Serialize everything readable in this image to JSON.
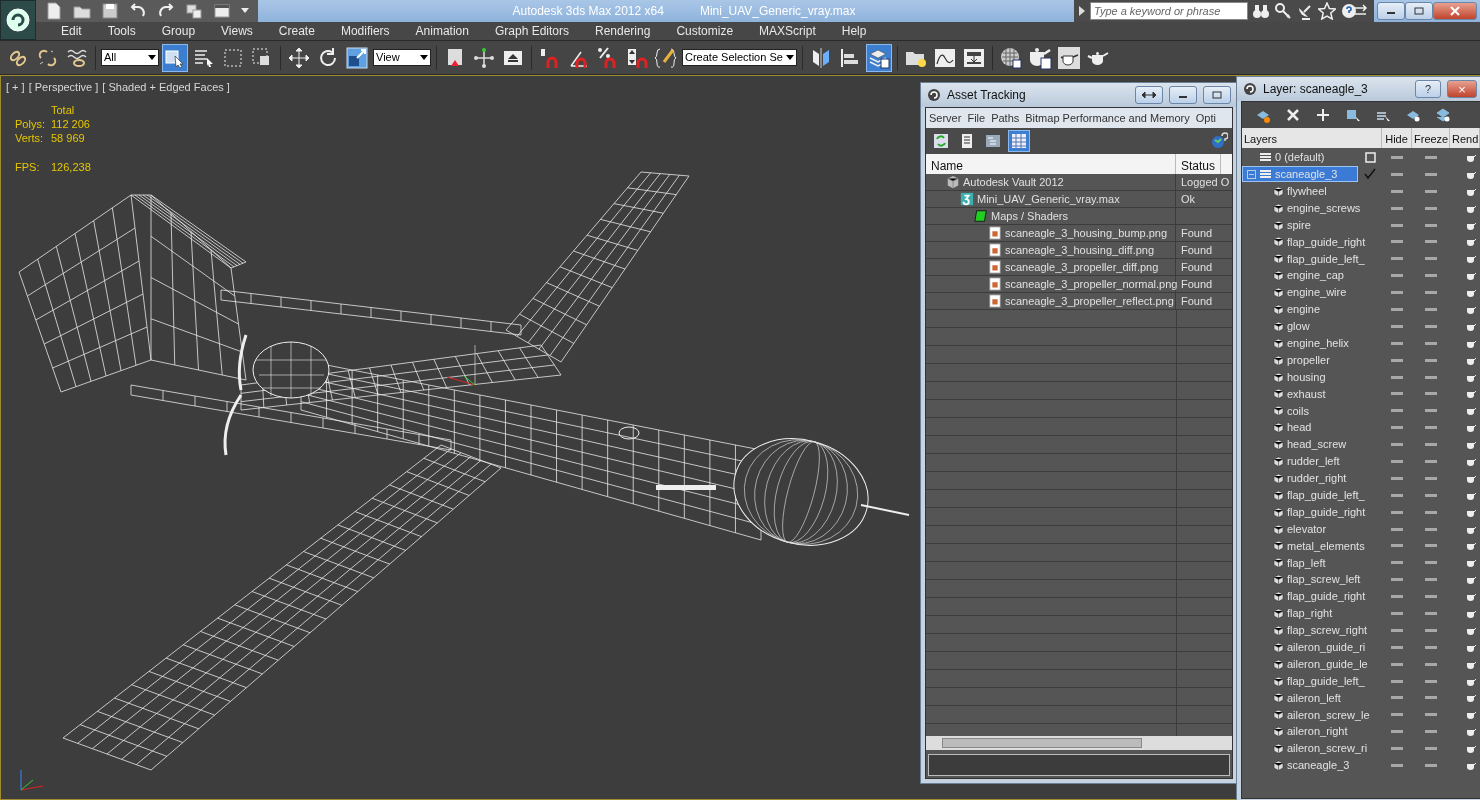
{
  "title_bar": {
    "app_title": "Autodesk 3ds Max  2012 x64",
    "file_name": "Mini_UAV_Generic_vray.max",
    "search": {
      "placeholder": "Type a keyword or phrase"
    }
  },
  "menu": [
    "Edit",
    "Tools",
    "Group",
    "Views",
    "Create",
    "Modifiers",
    "Animation",
    "Graph Editors",
    "Rendering",
    "Customize",
    "MAXScript",
    "Help"
  ],
  "main_toolbar": [
    {
      "kind": "button",
      "selected": false
    },
    {
      "kind": "button",
      "selected": false
    },
    {
      "kind": "button",
      "selected": false
    },
    {
      "kind": "dropdown",
      "value": "All"
    },
    {
      "kind": "button",
      "selected": true
    },
    {
      "kind": "button",
      "selected": false
    },
    {
      "kind": "button",
      "selected": false
    },
    {
      "kind": "button",
      "selected": false
    },
    {
      "kind": "button",
      "selected": false
    },
    {
      "kind": "button",
      "selected": false
    },
    {
      "kind": "button",
      "selected": false
    },
    {
      "kind": "dropdown",
      "value": "View"
    },
    {
      "kind": "button",
      "selected": false
    },
    {
      "kind": "button",
      "selected": false
    },
    {
      "kind": "button",
      "selected": false
    },
    {
      "kind": "button",
      "selected": false
    },
    {
      "kind": "button",
      "selected": false
    },
    {
      "kind": "button",
      "selected": false
    },
    {
      "kind": "button",
      "selected": false
    },
    {
      "kind": "button",
      "selected": false
    },
    {
      "kind": "dropdown",
      "value": "Create Selection Se"
    },
    {
      "kind": "button",
      "selected": false
    },
    {
      "kind": "button",
      "selected": false
    },
    {
      "kind": "button",
      "selected": true
    },
    {
      "kind": "button",
      "selected": false
    },
    {
      "kind": "button",
      "selected": false
    },
    {
      "kind": "button",
      "selected": false
    },
    {
      "kind": "button",
      "selected": false
    },
    {
      "kind": "button",
      "selected": false
    },
    {
      "kind": "button",
      "selected": false
    },
    {
      "kind": "button",
      "selected": false
    }
  ],
  "viewport": {
    "active": true,
    "labels": [
      "[ + ]",
      "[ Perspective ]",
      "[ Shaded + Edged Faces ]"
    ],
    "stats_header": "Total",
    "stats": [
      {
        "label": "Polys:",
        "value": "112 206"
      },
      {
        "label": "Verts:",
        "value": "58 969"
      }
    ],
    "fps": {
      "label": "FPS:",
      "value": "126,238"
    }
  },
  "asset_tracking": {
    "title": "Asset Tracking",
    "menu": [
      "Server",
      "File",
      "Paths",
      "Bitmap Performance and Memory",
      "Opti"
    ],
    "toolbar": [
      {
        "selected": false
      },
      {
        "selected": false
      },
      {
        "selected": false
      },
      {
        "selected": true
      }
    ],
    "columns": [
      "Name",
      "Status"
    ],
    "rows": [
      {
        "kind": "vault",
        "name": "Autodesk Vault 2012",
        "status": "Logged O",
        "children": [
          {
            "kind": "scene",
            "name": "Mini_UAV_Generic_vray.max",
            "status": "Ok",
            "children": [
              {
                "kind": "folder",
                "name": "Maps / Shaders",
                "children": [
                  {
                    "kind": "image",
                    "name": "scaneagle_3_housing_bump.png",
                    "status": "Found"
                  },
                  {
                    "kind": "image",
                    "name": "scaneagle_3_housing_diff.png",
                    "status": "Found"
                  },
                  {
                    "kind": "image",
                    "name": "scaneagle_3_propeller_diff.png",
                    "status": "Found"
                  },
                  {
                    "kind": "image",
                    "name": "scaneagle_3_propeller_normal.png",
                    "status": "Found"
                  },
                  {
                    "kind": "image",
                    "name": "scaneagle_3_propeller_reflect.png",
                    "status": "Found"
                  }
                ]
              }
            ]
          }
        ]
      }
    ]
  },
  "layer_manager": {
    "title": "Layer: scaneagle_3",
    "title_buttons": [
      "?",
      "×"
    ],
    "columns": [
      "Layers",
      "Hide",
      "Freeze",
      "Rend"
    ],
    "rows": [
      {
        "kind": "layer",
        "name": "0 (default)",
        "current": false,
        "selected": false,
        "hide": false,
        "freeze": false
      },
      {
        "kind": "layer",
        "name": "scaneagle_3",
        "current": true,
        "selected": true,
        "expanded": true,
        "hide": false,
        "freeze": false,
        "children": [
          {
            "kind": "object",
            "name": "flywheel",
            "hide": false,
            "freeze": false
          },
          {
            "kind": "object",
            "name": "engine_screws",
            "hide": false,
            "freeze": false
          },
          {
            "kind": "object",
            "name": "spire",
            "hide": false,
            "freeze": false
          },
          {
            "kind": "object",
            "name": "flap_guide_right",
            "hide": false,
            "freeze": false
          },
          {
            "kind": "object",
            "name": "flap_guide_left_",
            "hide": false,
            "freeze": false
          },
          {
            "kind": "object",
            "name": "engine_cap",
            "hide": false,
            "freeze": false
          },
          {
            "kind": "object",
            "name": "engine_wire",
            "hide": false,
            "freeze": false
          },
          {
            "kind": "object",
            "name": "engine",
            "hide": false,
            "freeze": false
          },
          {
            "kind": "object",
            "name": "glow",
            "hide": false,
            "freeze": false
          },
          {
            "kind": "object",
            "name": "engine_helix",
            "hide": false,
            "freeze": false
          },
          {
            "kind": "object",
            "name": "propeller",
            "hide": false,
            "freeze": false
          },
          {
            "kind": "object",
            "name": "housing",
            "hide": false,
            "freeze": false
          },
          {
            "kind": "object",
            "name": "exhaust",
            "hide": false,
            "freeze": false
          },
          {
            "kind": "object",
            "name": "coils",
            "hide": false,
            "freeze": false
          },
          {
            "kind": "object",
            "name": "head",
            "hide": false,
            "freeze": false
          },
          {
            "kind": "object",
            "name": "head_screw",
            "hide": false,
            "freeze": false
          },
          {
            "kind": "object",
            "name": "rudder_left",
            "hide": false,
            "freeze": false
          },
          {
            "kind": "object",
            "name": "rudder_right",
            "hide": false,
            "freeze": false
          },
          {
            "kind": "object",
            "name": "flap_guide_left_",
            "hide": false,
            "freeze": false
          },
          {
            "kind": "object",
            "name": "flap_guide_right",
            "hide": false,
            "freeze": false
          },
          {
            "kind": "object",
            "name": "elevator",
            "hide": false,
            "freeze": false
          },
          {
            "kind": "object",
            "name": "metal_elements",
            "hide": false,
            "freeze": false
          },
          {
            "kind": "object",
            "name": "flap_left",
            "hide": false,
            "freeze": false
          },
          {
            "kind": "object",
            "name": "flap_screw_left",
            "hide": false,
            "freeze": false
          },
          {
            "kind": "object",
            "name": "flap_guide_right",
            "hide": false,
            "freeze": false
          },
          {
            "kind": "object",
            "name": "flap_right",
            "hide": false,
            "freeze": false
          },
          {
            "kind": "object",
            "name": "flap_screw_right",
            "hide": false,
            "freeze": false
          },
          {
            "kind": "object",
            "name": "aileron_guide_ri",
            "hide": false,
            "freeze": false
          },
          {
            "kind": "object",
            "name": "aileron_guide_le",
            "hide": false,
            "freeze": false
          },
          {
            "kind": "object",
            "name": "flap_guide_left_",
            "hide": false,
            "freeze": false
          },
          {
            "kind": "object",
            "name": "aileron_left",
            "hide": false,
            "freeze": false
          },
          {
            "kind": "object",
            "name": "aileron_screw_le",
            "hide": false,
            "freeze": false
          },
          {
            "kind": "object",
            "name": "aileron_right",
            "hide": false,
            "freeze": false
          },
          {
            "kind": "object",
            "name": "aileron_screw_ri",
            "hide": false,
            "freeze": false
          },
          {
            "kind": "object",
            "name": "scaneagle_3",
            "hide": false,
            "freeze": false
          }
        ]
      }
    ]
  }
}
